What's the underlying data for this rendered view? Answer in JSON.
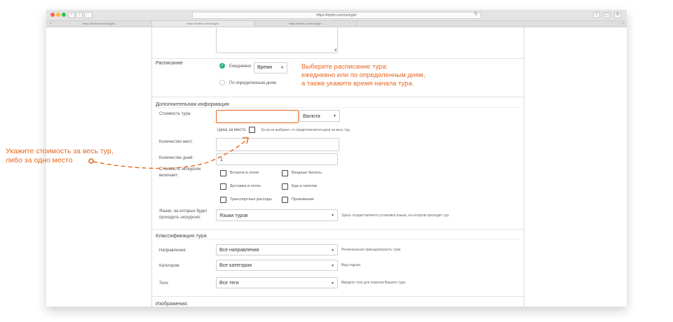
{
  "browser": {
    "url": "https://tripfer.com/ru/login/",
    "tabs": [
      "https://tripfer.com/ru/login/",
      "https://tripfer.com/ru/login/",
      "https://tripfer.com/ru/login/"
    ]
  },
  "schedule": {
    "label": "Расписание",
    "daily_label": "Ежедневно",
    "time_placeholder": "Время",
    "days_label": "По определенным дням"
  },
  "additional": {
    "title": "Дополнительная информация",
    "cost_label": "Стоимость тура:",
    "currency_label": "Валюта",
    "per_seat_label": "Цена за место",
    "per_seat_hint": "Если не выбрано, то предполагается цена за весь тур.",
    "seats_label": "Количество мест:",
    "days_label": "Количество дней:",
    "days_value": "1",
    "includes_label_1": "Стоимость экскурсии",
    "includes_label_2": "включает:",
    "includes": {
      "hotel_meeting": "Встреча в отеле",
      "tickets": "Входные билеты",
      "hotel_delivery": "Доставка в отель",
      "food": "Еда и напитки",
      "transport": "Транспортные расходы",
      "accommodation": "Проживание"
    },
    "languages_label_1": "Языки, на которых будет",
    "languages_label_2": "проходить экскурсия:",
    "languages_select": "Языки туров",
    "languages_hint": "Здесь осуществляется установка языка, на котором проходит тур."
  },
  "classification": {
    "title": "Классификация тура",
    "directions_label": "Направления:",
    "directions_select": "Все направления",
    "directions_hint": "Региональная принадлежность тура",
    "categories_label": "Категории:",
    "categories_select": "Все категории",
    "categories_hint": "Вид отдыха",
    "tags_label": "Теги:",
    "tags_select": "Все теги",
    "tags_hint": "Введите теги для пометки Вашего тура"
  },
  "images_label_cut": "Изображения:",
  "annotations": {
    "schedule_note_1": "Выберите расписание тура:",
    "schedule_note_2": "ежедневно или по определенным дням,",
    "schedule_note_3": "а также укажите время начала тура.",
    "cost_note_1": "Укажите стоимость за весь тур,",
    "cost_note_2": "либо за одно место"
  },
  "colors": {
    "accent": "#e8661f",
    "success": "#2fb27a"
  }
}
